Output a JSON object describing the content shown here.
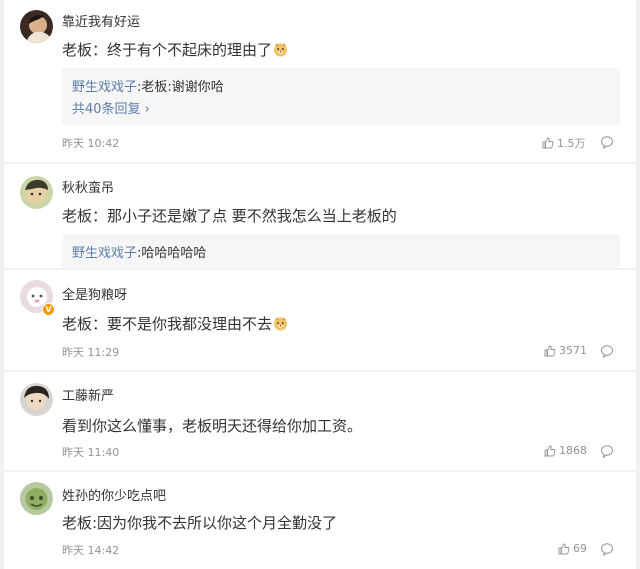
{
  "comments": [
    {
      "username": "靠近我有好运",
      "text": "老板：终于有个不起床的理由了",
      "emoji": "doge-emoji",
      "replies": [
        {
          "user": "野生戏戏子",
          "sep": ":",
          "text": "老板:谢谢你哈"
        }
      ],
      "more_replies": "共40条回复",
      "time": "昨天 10:42",
      "likes": "1.5万"
    },
    {
      "username": "秋秋蛮吊",
      "text": "老板：那小子还是嫩了点 要不然我怎么当上老板的",
      "replies": [
        {
          "user": "野生戏戏子",
          "sep": ":",
          "text": "哈哈哈哈哈"
        }
      ]
    },
    {
      "username": "全是狗粮呀",
      "badge": "V",
      "text": "老板：要不是你我都没理由不去",
      "emoji": "doge-emoji",
      "time": "昨天 11:29",
      "likes": "3571"
    },
    {
      "username": "工藤新严",
      "text": "看到你这么懂事，老板明天还得给你加工资。",
      "time": "昨天 11:40",
      "likes": "1868"
    },
    {
      "username": "姓孙的你少吃点吧",
      "text": "老板:因为你我不去所以你这个月全勤没了",
      "time": "昨天 14:42",
      "likes": "69"
    }
  ],
  "colors": {
    "page_bg": "#f1f1f1",
    "card_bg": "#ffffff",
    "text": "#333333",
    "link_blue": "#5d7ea9",
    "meta_gray": "#939393",
    "reply_bg": "#f6f6f6",
    "vip_badge": "#f39800"
  }
}
